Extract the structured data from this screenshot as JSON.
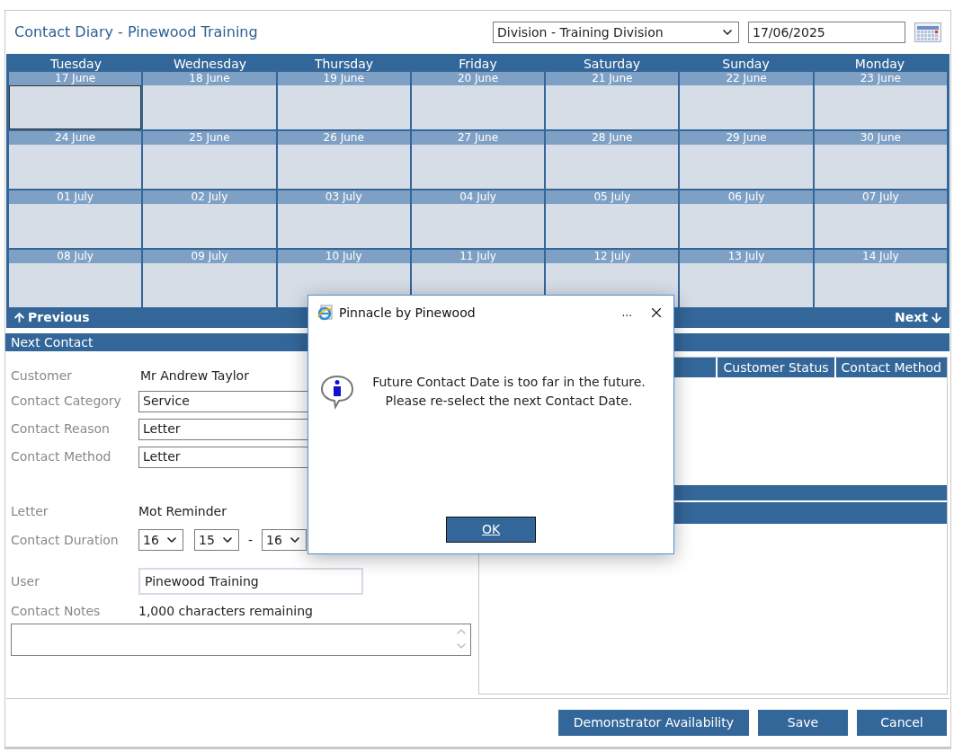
{
  "title": "Contact Diary - Pinewood Training",
  "division": {
    "value": "Division - Training Division"
  },
  "date_field": {
    "value": "17/06/2025"
  },
  "calendar": {
    "weekdays": [
      "Tuesday",
      "Wednesday",
      "Thursday",
      "Friday",
      "Saturday",
      "Sunday",
      "Monday"
    ],
    "weeks": [
      [
        {
          "date": "17 June",
          "selected": true
        },
        {
          "date": "18 June",
          "selected": false
        },
        {
          "date": "19 June",
          "selected": false
        },
        {
          "date": "20 June",
          "selected": false
        },
        {
          "date": "21 June",
          "selected": false
        },
        {
          "date": "22 June",
          "selected": false
        },
        {
          "date": "23 June",
          "selected": false
        }
      ],
      [
        {
          "date": "24 June",
          "selected": false
        },
        {
          "date": "25 June",
          "selected": false
        },
        {
          "date": "26 June",
          "selected": false
        },
        {
          "date": "27 June",
          "selected": false
        },
        {
          "date": "28 June",
          "selected": false
        },
        {
          "date": "29 June",
          "selected": false
        },
        {
          "date": "30 June",
          "selected": false
        }
      ],
      [
        {
          "date": "01 July",
          "selected": false
        },
        {
          "date": "02 July",
          "selected": false
        },
        {
          "date": "03 July",
          "selected": false
        },
        {
          "date": "04 July",
          "selected": false
        },
        {
          "date": "05 July",
          "selected": false
        },
        {
          "date": "06 July",
          "selected": false
        },
        {
          "date": "07 July",
          "selected": false
        }
      ],
      [
        {
          "date": "08 July",
          "selected": false
        },
        {
          "date": "09 July",
          "selected": false
        },
        {
          "date": "10 July",
          "selected": false
        },
        {
          "date": "11 July",
          "selected": false
        },
        {
          "date": "12 July",
          "selected": false
        },
        {
          "date": "13 July",
          "selected": false
        },
        {
          "date": "14 July",
          "selected": false
        }
      ]
    ],
    "previous": "Previous",
    "next": "Next"
  },
  "next_contact": {
    "heading": "Next Contact",
    "customer": {
      "label": "Customer",
      "value": "Mr Andrew Taylor"
    },
    "selects": [
      {
        "label": "Contact Category",
        "value": "Service"
      },
      {
        "label": "Contact Reason",
        "value": "Letter"
      },
      {
        "label": "Contact Method",
        "value": "Letter"
      }
    ],
    "letter": {
      "label": "Letter",
      "value": "Mot Reminder"
    },
    "duration": {
      "label": "Contact Duration",
      "from_hour": "16",
      "from_minute": "15",
      "separator": "-",
      "to_hour": "16"
    },
    "user": {
      "label": "User",
      "value": "Pinewood Training"
    },
    "notes": {
      "label": "Contact Notes",
      "remaining": "1,000 characters remaining"
    }
  },
  "history_table": {
    "columns": [
      "Customer Status",
      "Contact Method"
    ]
  },
  "buttons": [
    "Demonstrator Availability",
    "Save",
    "Cancel"
  ],
  "dialog": {
    "title": "Pinnacle by Pinewood",
    "more": "...",
    "message": [
      "Future Contact Date is too far in the future.",
      "Please re-select the next Contact Date."
    ],
    "ok": "OK"
  }
}
